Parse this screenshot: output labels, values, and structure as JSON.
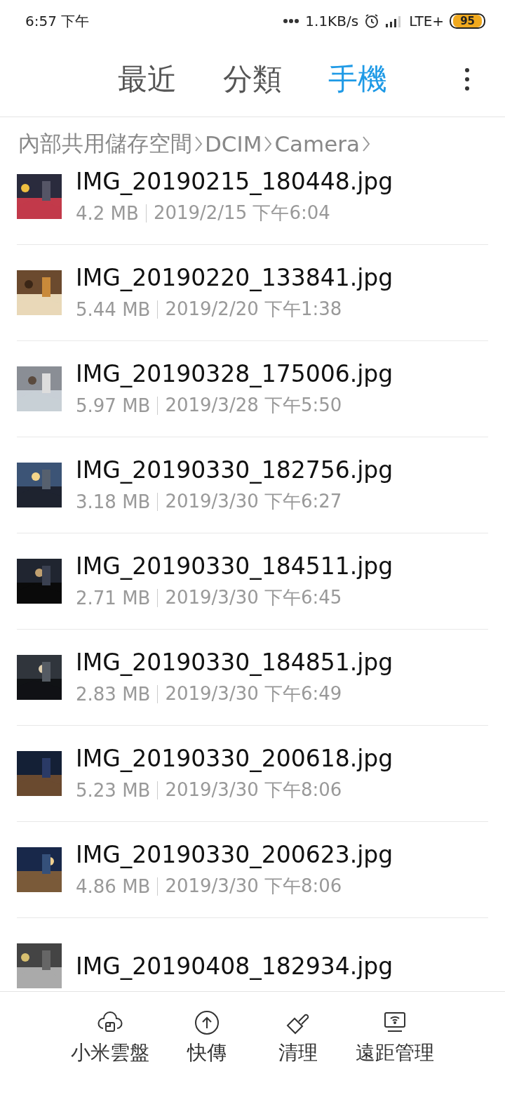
{
  "status_bar": {
    "time": "6:57 下午",
    "speed": "1.1KB/s",
    "network": "LTE+",
    "battery": "95"
  },
  "tabs": [
    {
      "label": "最近",
      "selected": false
    },
    {
      "label": "分類",
      "selected": false
    },
    {
      "label": "手機",
      "selected": true
    }
  ],
  "breadcrumb": [
    "內部共用儲存空間",
    "DCIM",
    "Camera"
  ],
  "files": [
    {
      "name": "IMG_20190215_180448.jpg",
      "size": "4.2 MB",
      "date": "2019/2/15 下午6:04",
      "kind": "picture"
    },
    {
      "name": "IMG_20190220_133841.jpg",
      "size": "5.44 MB",
      "date": "2019/2/20 下午1:38",
      "kind": "picture"
    },
    {
      "name": "IMG_20190328_175006.jpg",
      "size": "5.97 MB",
      "date": "2019/3/28 下午5:50",
      "kind": "picture"
    },
    {
      "name": "IMG_20190330_182756.jpg",
      "size": "3.18 MB",
      "date": "2019/3/30 下午6:27",
      "kind": "picture"
    },
    {
      "name": "IMG_20190330_184511.jpg",
      "size": "2.71 MB",
      "date": "2019/3/30 下午6:45",
      "kind": "picture"
    },
    {
      "name": "IMG_20190330_184851.jpg",
      "size": "2.83 MB",
      "date": "2019/3/30 下午6:49",
      "kind": "picture"
    },
    {
      "name": "IMG_20190330_200618.jpg",
      "size": "5.23 MB",
      "date": "2019/3/30 下午8:06",
      "kind": "picture"
    },
    {
      "name": "IMG_20190330_200623.jpg",
      "size": "4.86 MB",
      "date": "2019/3/30 下午8:06",
      "kind": "picture"
    },
    {
      "name": "IMG_20190408_182934.jpg",
      "kind": "picture"
    }
  ],
  "bottom_nav": [
    {
      "label": "小米雲盤"
    },
    {
      "label": "快傳"
    },
    {
      "label": "清理"
    },
    {
      "label": "遠距管理"
    }
  ]
}
